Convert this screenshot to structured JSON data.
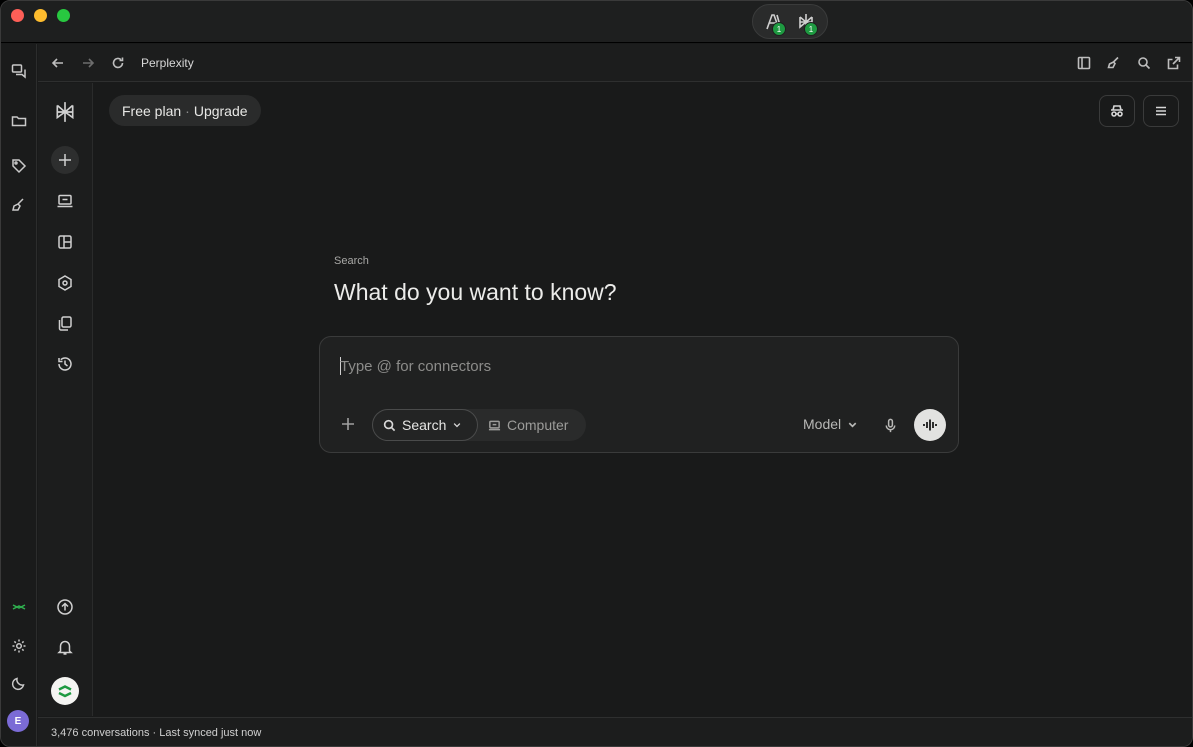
{
  "window": {
    "title": "Perplexity"
  },
  "titlebar": {
    "services": [
      {
        "icon": "chat-bubbles-icon",
        "active": false
      },
      {
        "icon": "openai-icon",
        "active": false
      },
      {
        "icon": "anthropic-icon",
        "active": false,
        "status": "online"
      },
      {
        "icon": "gemini-sparkle-icon",
        "active": false,
        "status": "online"
      },
      {
        "icon": "perplexity-icon",
        "active": true,
        "status": "online"
      },
      {
        "icon": "deepseek-icon",
        "active": false
      },
      {
        "icon": "grok-icon",
        "active": false
      },
      {
        "icon": "compose-sparkle-icon",
        "active": false
      }
    ],
    "side_services": [
      {
        "icon": "anthropic-icon",
        "badge": "1"
      },
      {
        "icon": "perplexity-icon",
        "badge": "1"
      }
    ]
  },
  "toolbar": {
    "title": "Perplexity"
  },
  "main": {
    "plan": {
      "plan_label": "Free plan",
      "separator": "·",
      "upgrade_label": "Upgrade"
    },
    "search_label": "Search",
    "headline": "What do you want to know?",
    "composer": {
      "placeholder": "Type @ for connectors",
      "modes": {
        "active_label": "Search",
        "other_label": "Computer"
      },
      "model_label": "Model"
    }
  },
  "statusbar": {
    "text": "3,476 conversations · Last synced just now"
  },
  "rail": {
    "avatar_initial": "E"
  },
  "colors": {
    "accent": "#2fb14f",
    "background": "#191a1a",
    "avatar": "#7b6bd6"
  }
}
